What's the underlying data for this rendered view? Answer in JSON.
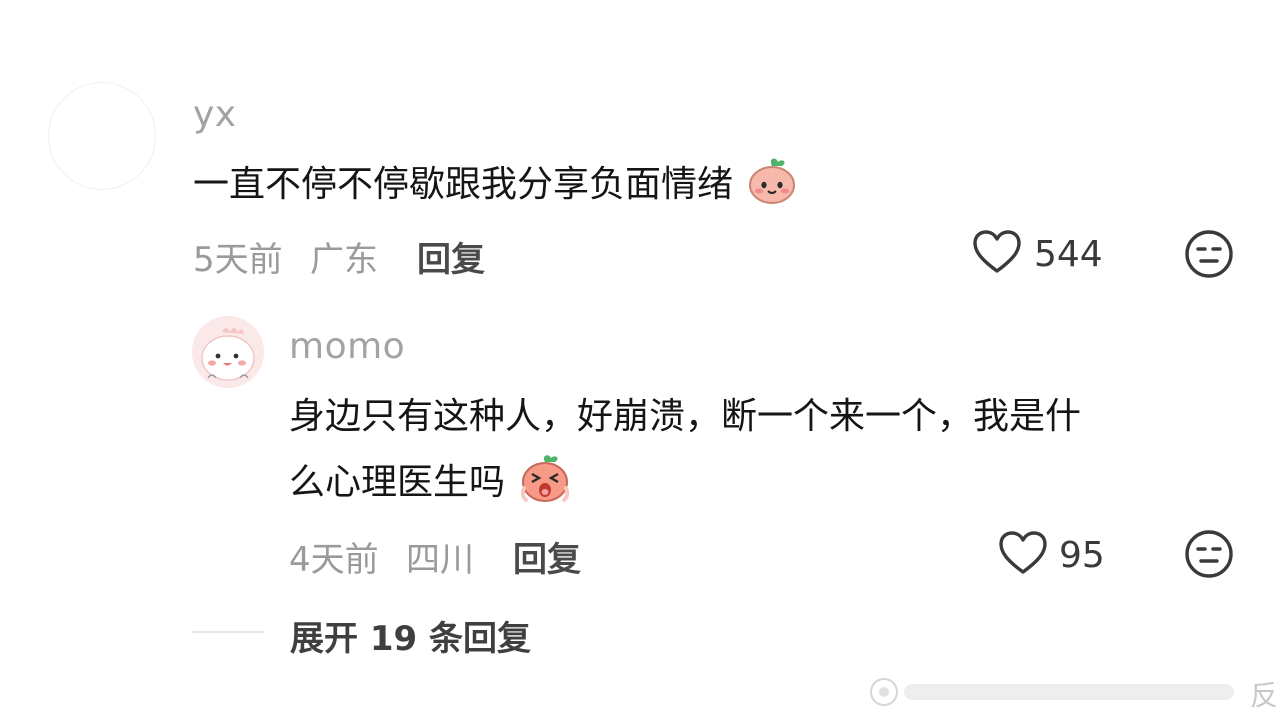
{
  "comment": {
    "username": "yx",
    "text": "一直不停不停歇跟我分享负面情绪",
    "time": "5天前",
    "location": "广东",
    "reply_label": "回复",
    "like_count": "544"
  },
  "reply": {
    "username": "momo",
    "text_line1": "身边只有这种人，好崩溃，断一个来一个，我是什",
    "text_line2": "么心理医生吗",
    "time": "4天前",
    "location": "四川",
    "reply_label": "回复",
    "like_count": "95"
  },
  "expand": {
    "label": "展开 19 条回复"
  },
  "watermark": {
    "text": "反"
  },
  "icons": {
    "like": "heart-outline-icon",
    "dislike": "neutral-face-icon",
    "emoji_smile": "peach-smile-emoji",
    "emoji_cry": "peach-cry-emoji"
  },
  "colors": {
    "username": "#a3a3a3",
    "text": "#151515",
    "meta": "#9a9a9a"
  }
}
